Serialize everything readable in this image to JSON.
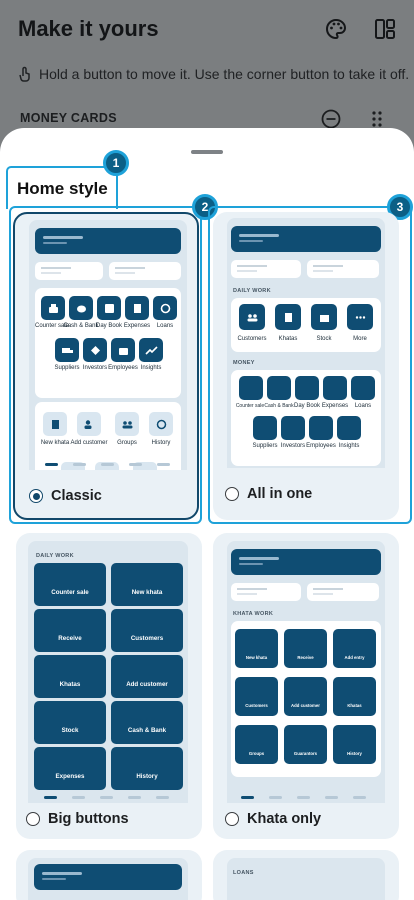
{
  "header": {
    "title": "Make it yours",
    "hint": "Hold a button to move it. Use the corner button to take it off."
  },
  "section": {
    "label": "MONEY CARDS"
  },
  "sheet": {
    "title": "Home style"
  },
  "badges": [
    "1",
    "2",
    "3"
  ],
  "options": {
    "classic": "Classic",
    "all_in_one": "All in one",
    "big_buttons": "Big buttons",
    "khata_only": "Khata only"
  },
  "selected": "Classic",
  "classic_preview": {
    "money_row1": [
      "Counter sale",
      "Cash & Bank",
      "Day Book",
      "Expenses",
      "Loans"
    ],
    "money_row2": [
      "Suppliers",
      "Investors",
      "Employees",
      "Insights"
    ],
    "khata_row": [
      "New khata",
      "Add customer",
      "Groups",
      "History"
    ]
  },
  "allinone_preview": {
    "daily_caption": "DAILY WORK",
    "daily_items": [
      "Customers",
      "Khatas",
      "Stock",
      "More"
    ],
    "money_caption": "MONEY",
    "money_row1": [
      "Counter sale",
      "Cash & Bank",
      "Day Book",
      "Expenses",
      "Loans"
    ],
    "money_row2": [
      "Suppliers",
      "Investors",
      "Employees",
      "Insights"
    ]
  },
  "big_preview": {
    "caption": "DAILY WORK",
    "items": [
      "Counter sale",
      "New khata",
      "Receive",
      "Customers",
      "Khatas",
      "Add customer",
      "Stock",
      "Cash & Bank",
      "Expenses",
      "History"
    ]
  },
  "khata_preview": {
    "caption": "KHATA WORK",
    "items": [
      "New khata",
      "Receive",
      "Add entry",
      "Customers",
      "Add customer",
      "Khatas",
      "Groups",
      "Guarantors",
      "History"
    ]
  },
  "bottom_preview": {
    "caption": "LOANS"
  },
  "colors": {
    "accent": "#1ea2d9",
    "primary": "#0f4d73",
    "card_bg": "#eaf1f6",
    "overlay": "#7b7e80"
  }
}
